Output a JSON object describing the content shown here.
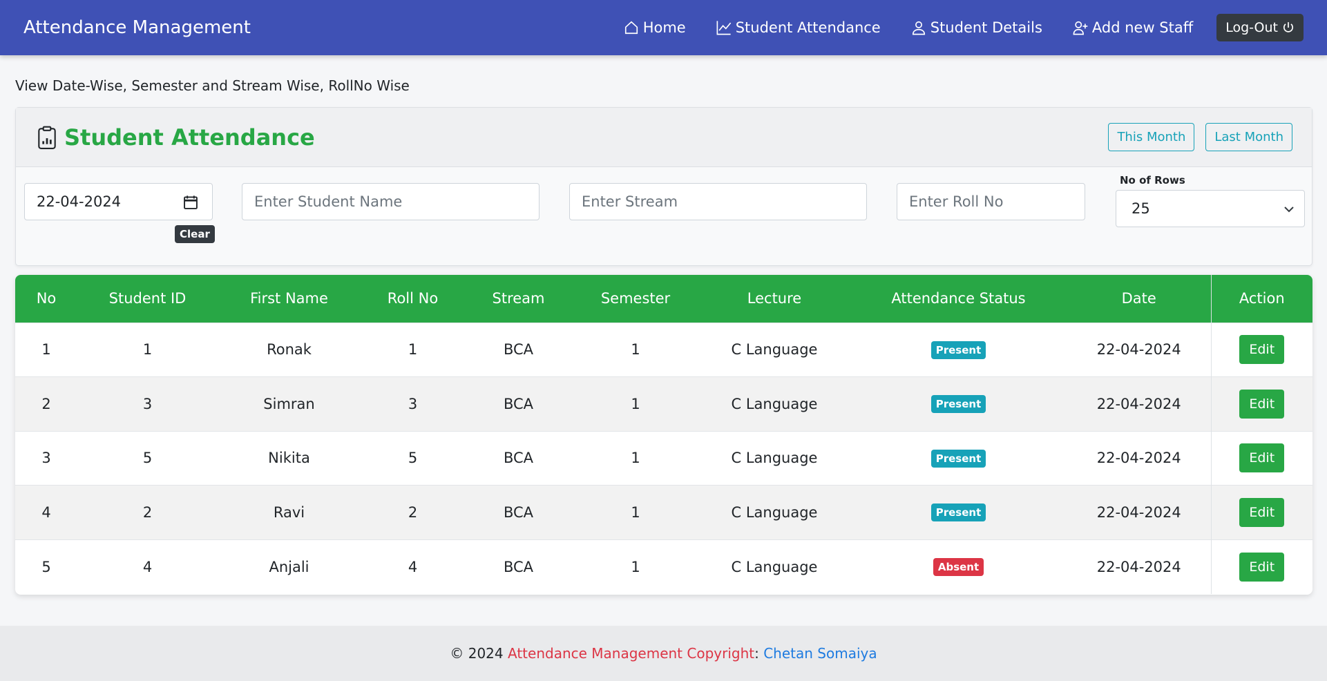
{
  "navbar": {
    "brand": "Attendance Management",
    "links": [
      {
        "label": "Home",
        "icon": "home-icon"
      },
      {
        "label": "Student Attendance",
        "icon": "chart-line-icon"
      },
      {
        "label": "Student Details",
        "icon": "person-icon"
      },
      {
        "label": "Add new Staff",
        "icon": "person-plus-icon"
      }
    ],
    "logout_label": "Log-Out",
    "color": "#3f51b5"
  },
  "subtitle": "View Date-Wise, Semester and Stream Wise, RollNo Wise",
  "card": {
    "title": "Student Attendance",
    "this_month": "This Month",
    "last_month": "Last Month"
  },
  "filters": {
    "date_value": "22-04-2024",
    "clear_label": "Clear",
    "student_name_placeholder": "Enter Student Name",
    "stream_placeholder": "Enter Stream",
    "roll_no_placeholder": "Enter Roll No",
    "rows_label": "No of Rows",
    "rows_value": "25"
  },
  "table": {
    "headers": [
      "No",
      "Student ID",
      "First Name",
      "Roll No",
      "Stream",
      "Semester",
      "Lecture",
      "Attendance Status",
      "Date",
      "Action"
    ],
    "rows": [
      {
        "no": "1",
        "student_id": "1",
        "first_name": "Ronak",
        "roll_no": "1",
        "stream": "BCA",
        "semester": "1",
        "lecture": "C Language",
        "status": "Present",
        "date": "22-04-2024",
        "action": "Edit"
      },
      {
        "no": "2",
        "student_id": "3",
        "first_name": "Simran",
        "roll_no": "3",
        "stream": "BCA",
        "semester": "1",
        "lecture": "C Language",
        "status": "Present",
        "date": "22-04-2024",
        "action": "Edit"
      },
      {
        "no": "3",
        "student_id": "5",
        "first_name": "Nikita",
        "roll_no": "5",
        "stream": "BCA",
        "semester": "1",
        "lecture": "C Language",
        "status": "Present",
        "date": "22-04-2024",
        "action": "Edit"
      },
      {
        "no": "4",
        "student_id": "2",
        "first_name": "Ravi",
        "roll_no": "2",
        "stream": "BCA",
        "semester": "1",
        "lecture": "C Language",
        "status": "Present",
        "date": "22-04-2024",
        "action": "Edit"
      },
      {
        "no": "5",
        "student_id": "4",
        "first_name": "Anjali",
        "roll_no": "4",
        "stream": "BCA",
        "semester": "1",
        "lecture": "C Language",
        "status": "Absent",
        "date": "22-04-2024",
        "action": "Edit"
      }
    ]
  },
  "footer": {
    "prefix": "© 2024",
    "app": "Attendance Management Copyright",
    "separator": ":",
    "author": "Chetan Somaiya"
  },
  "colors": {
    "primary_green": "#28a745",
    "info": "#17a2b8",
    "danger": "#dc3545"
  }
}
